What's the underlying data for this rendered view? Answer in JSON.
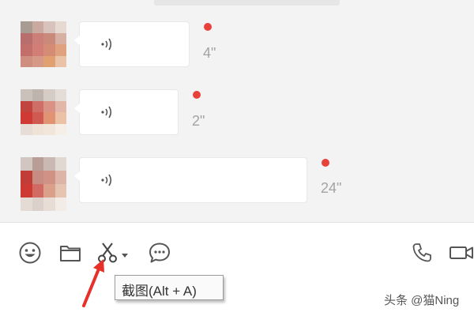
{
  "messages": [
    {
      "duration": "4\"",
      "unread": true
    },
    {
      "duration": "2\"",
      "unread": true
    },
    {
      "duration": "24\"",
      "unread": true
    }
  ],
  "toolbar": {
    "icons": [
      "emoji-icon",
      "folder-icon",
      "scissors-icon",
      "chevron-down-icon",
      "chat-bubble-icon",
      "phone-icon",
      "video-icon"
    ],
    "tooltip": "截图(Alt + A)"
  },
  "watermark": "头条 @猫Ning",
  "colors": {
    "unread_dot": "#e8413a",
    "annotation_arrow": "#e8302a",
    "chat_background": "#f3f3f3"
  }
}
